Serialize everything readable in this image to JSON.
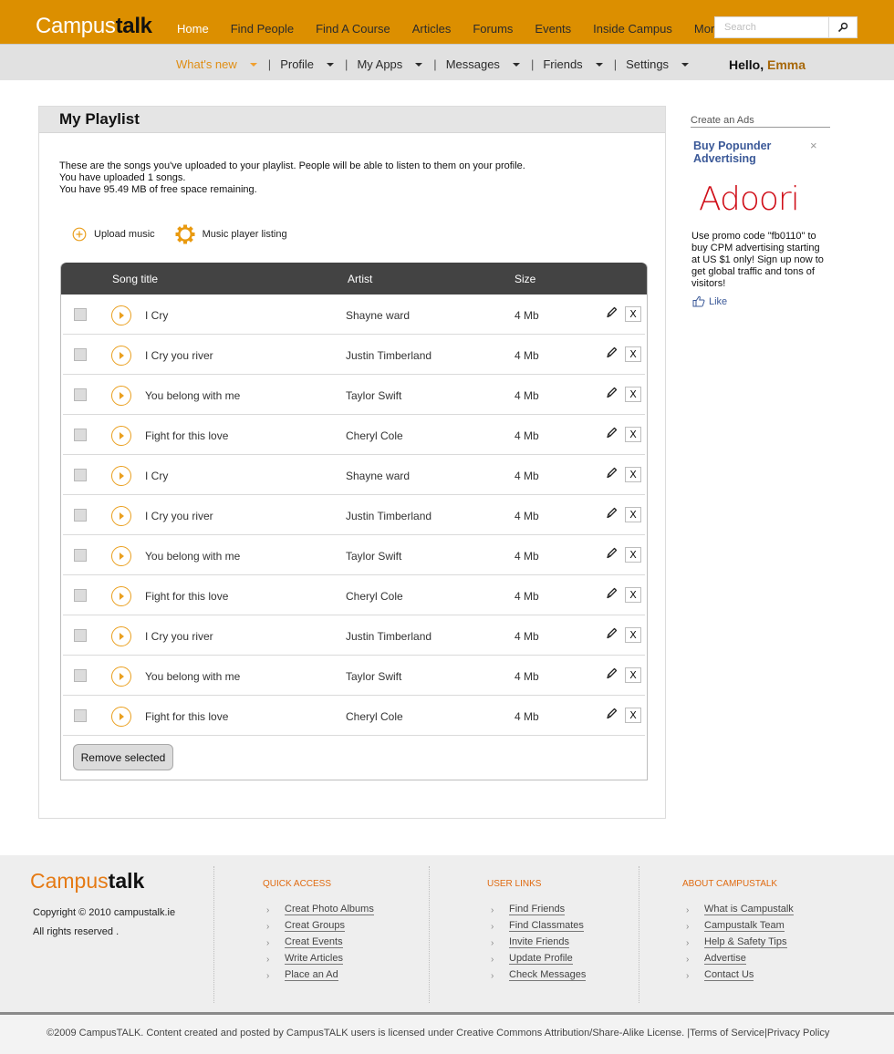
{
  "header": {
    "logo": {
      "part1": "Campus",
      "part2": "talk"
    },
    "nav": [
      {
        "label": "Home",
        "active": true
      },
      {
        "label": "Find People"
      },
      {
        "label": "Find A Course"
      },
      {
        "label": "Articles"
      },
      {
        "label": "Forums"
      },
      {
        "label": "Events"
      },
      {
        "label": "Inside Campus"
      },
      {
        "label": "More"
      }
    ],
    "search": {
      "placeholder": "Search",
      "value": "",
      "icon": "search-icon"
    },
    "brand_color": "#dc8f00"
  },
  "subnav": {
    "items": [
      {
        "label": "What's new",
        "active": true
      },
      {
        "label": "Profile"
      },
      {
        "label": "My Apps"
      },
      {
        "label": "Messages"
      },
      {
        "label": "Friends"
      },
      {
        "label": "Settings"
      }
    ],
    "greeting": "Hello,",
    "user_name": "Emma"
  },
  "playlist": {
    "title": "My Playlist",
    "intro": [
      "These are the songs you've uploaded to your playlist. People will be able to listen to them on your profile.",
      "You have uploaded 1 songs.",
      "You have 95.49 MB of free space remaining."
    ],
    "actions": {
      "upload": {
        "label": "Upload music",
        "icon": "plus-circle-icon"
      },
      "listing": {
        "label": "Music player listing",
        "icon": "gear-icon"
      }
    },
    "columns": {
      "title": "Song title",
      "artist": "Artist",
      "size": "Size"
    },
    "rows": [
      {
        "title": "I Cry",
        "artist": "Shayne ward",
        "size": "4 Mb",
        "checked": false
      },
      {
        "title": "I Cry you river",
        "artist": "Justin Timberland",
        "size": "4 Mb",
        "checked": false
      },
      {
        "title": "You belong with me",
        "artist": "Taylor Swift",
        "size": "4 Mb",
        "checked": false
      },
      {
        "title": "Fight for this love",
        "artist": "Cheryl Cole",
        "size": "4 Mb",
        "checked": false
      },
      {
        "title": "I Cry",
        "artist": "Shayne ward",
        "size": "4 Mb",
        "checked": false
      },
      {
        "title": "I Cry you river",
        "artist": "Justin Timberland",
        "size": "4 Mb",
        "checked": false
      },
      {
        "title": "You belong with me",
        "artist": "Taylor Swift",
        "size": "4 Mb",
        "checked": false
      },
      {
        "title": "Fight for this love",
        "artist": "Cheryl Cole",
        "size": "4 Mb",
        "checked": false
      },
      {
        "title": "I Cry you river",
        "artist": "Justin Timberland",
        "size": "4 Mb",
        "checked": false
      },
      {
        "title": "You belong with me",
        "artist": "Taylor Swift",
        "size": "4 Mb",
        "checked": false
      },
      {
        "title": "Fight for this love",
        "artist": "Cheryl Cole",
        "size": "4 Mb",
        "checked": false
      }
    ],
    "delete_label": "X",
    "remove_selected_label": "Remove selected"
  },
  "ads": {
    "section_title": "Create an Ads",
    "headline": "Buy Popunder Advertising",
    "close_label": "×",
    "logo_text": "Adoori",
    "body": "Use promo code \"fb0110\" to buy CPM advertising starting at US $1 only! Sign up now to get global traffic and tons of visitors!",
    "like_label": "Like"
  },
  "footer": {
    "logo": {
      "part1": "Campus",
      "part2": "talk"
    },
    "copyright": "Copyright © 2010 campustalk.ie",
    "rights": "All rights reserved .",
    "columns": [
      {
        "heading": "QUICK ACCESS",
        "links": [
          "Creat Photo Albums",
          "Creat Groups",
          "Creat Events",
          "Write Articles",
          "Place an Ad"
        ]
      },
      {
        "heading": "USER LINKS",
        "links": [
          "Find Friends",
          "Find Classmates",
          "Invite Friends",
          "Update Profile",
          "Check Messages"
        ]
      },
      {
        "heading": "ABOUT CAMPUSTALK",
        "links": [
          "What is Campustalk",
          "Campustalk Team",
          "Help & Safety Tips",
          "Advertise",
          "Contact Us"
        ]
      }
    ],
    "license": "©2009 CampusTALK. Content created and posted by CampusTALK users is licensed under Creative Commons Attribution/Share-Alike License. |",
    "terms_label": "Terms of Service",
    "privacy_label": "Privacy Policy"
  }
}
